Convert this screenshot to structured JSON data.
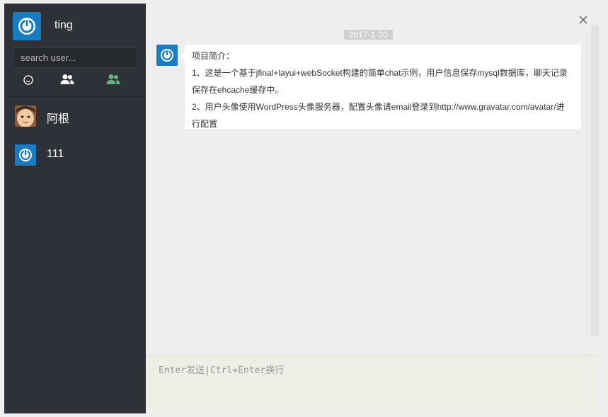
{
  "user": {
    "name": "ting",
    "avatar_icon": "power-icon"
  },
  "search": {
    "placeholder": "search user..."
  },
  "tabs": [
    {
      "icon": "smiley-icon"
    },
    {
      "icon": "users-icon"
    },
    {
      "icon": "group-icon",
      "color": "#5fb878"
    }
  ],
  "contacts": [
    {
      "name": "阿根",
      "avatar": "baby-photo"
    },
    {
      "name": "111",
      "avatar": "power-icon"
    }
  ],
  "chat": {
    "date": "2017-1-20",
    "message": {
      "lines": [
        "项目简介：",
        "1、这是一个基于jfinal+layui+webSocket构建的简单chat示例，用户信息保存mysql数据库，聊天记录",
        "保存在ehcache缓存中。",
        "2、用户头像使用WordPress头像服务器，配置头像请email登录到http://www.gravatar.com/avatar/进",
        "行配置"
      ]
    }
  },
  "input": {
    "placeholder": "Enter发送|Ctrl+Enter换行"
  },
  "colors": {
    "accent": "#1a7cc0",
    "sidebar": "#2e3238",
    "green": "#5fb878"
  }
}
